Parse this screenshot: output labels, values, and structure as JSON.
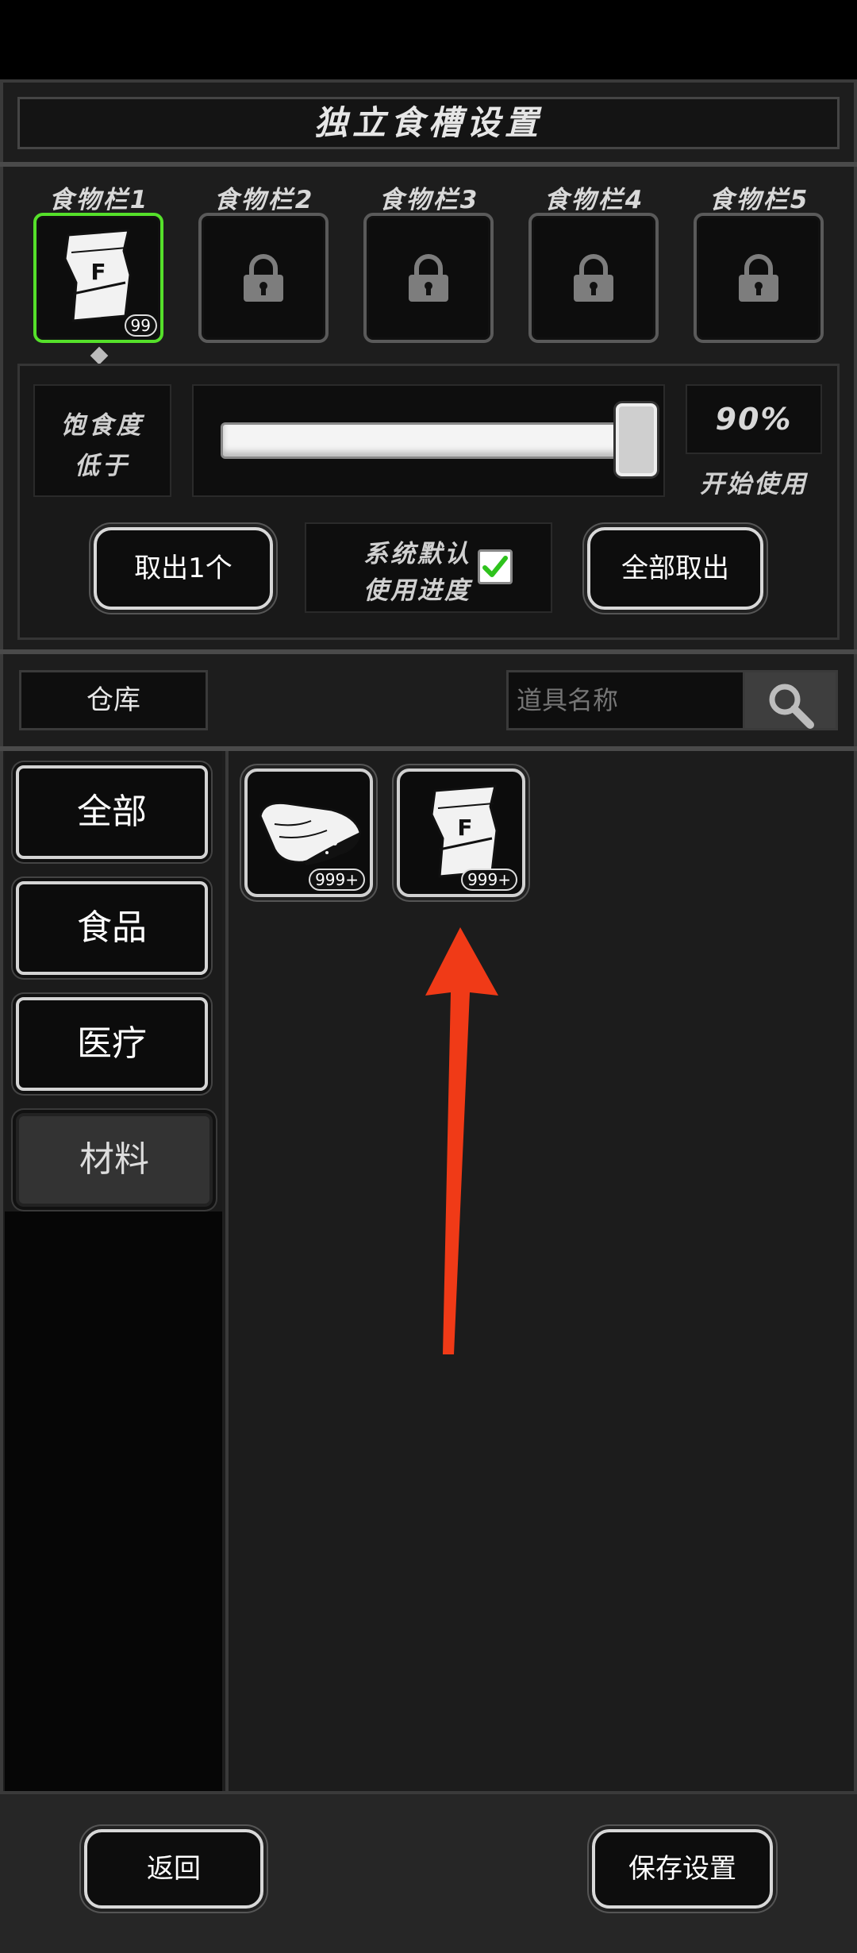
{
  "title": "独立食槽设置",
  "slots": [
    {
      "label": "食物栏1",
      "count": "99",
      "active": true
    },
    {
      "label": "食物栏2",
      "locked": true
    },
    {
      "label": "食物栏3",
      "locked": true
    },
    {
      "label": "食物栏4",
      "locked": true
    },
    {
      "label": "食物栏5",
      "locked": true
    }
  ],
  "settings": {
    "satiety_line1": "饱食度",
    "satiety_line2": "低于",
    "threshold_percent": 90,
    "threshold_text": "90%",
    "start_label": "开始使用",
    "take_one": "取出1个",
    "default_line1": "系统默认",
    "default_line2": "使用进度",
    "default_checked": true,
    "take_all": "全部取出"
  },
  "warehouse": {
    "tab": "仓库",
    "search_placeholder": "道具名称"
  },
  "categories": [
    {
      "label": "全部"
    },
    {
      "label": "食品"
    },
    {
      "label": "医疗"
    },
    {
      "label": "材料",
      "selected": true
    }
  ],
  "items": [
    {
      "icon": "meat-icon",
      "count": "999+"
    },
    {
      "icon": "food-bag-icon",
      "count": "999+"
    }
  ],
  "footer": {
    "back": "返回",
    "save": "保存设置"
  },
  "colors": {
    "active_slot": "#55e02a",
    "check": "#2ec21c",
    "arrow": "#f03a17"
  }
}
